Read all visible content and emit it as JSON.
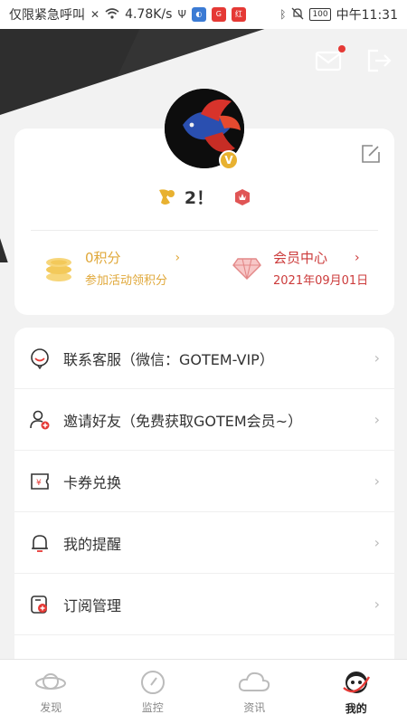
{
  "status_bar": {
    "left_text": "仅限紧急呼叫",
    "speed": "4.78K/s",
    "battery": "100",
    "time": "中午11:31"
  },
  "profile": {
    "badge_letter": "V",
    "username": "2！",
    "points": {
      "value": "0积分",
      "subtitle": "参加活动领积分"
    },
    "member": {
      "title": "会员中心",
      "date": "2021年09月01日"
    }
  },
  "menu": [
    {
      "label": "联系客服（微信：GOTEM-VIP）",
      "icon": "headset-icon"
    },
    {
      "label": "邀请好友（免费获取GOTEM会员~）",
      "icon": "invite-user-icon"
    },
    {
      "label": "卡券兑换",
      "icon": "coupon-icon"
    },
    {
      "label": "我的提醒",
      "icon": "bell-icon"
    },
    {
      "label": "订阅管理",
      "icon": "subscription-icon"
    }
  ],
  "tabs": [
    {
      "label": "发现",
      "icon": "planet-icon",
      "active": false
    },
    {
      "label": "监控",
      "icon": "compass-icon",
      "active": false
    },
    {
      "label": "资讯",
      "icon": "cloud-icon",
      "active": false
    },
    {
      "label": "我的",
      "icon": "profile-face-icon",
      "active": true
    }
  ],
  "colors": {
    "gold": "#e0a83a",
    "member_red": "#cc3b3b",
    "header_dark": "#2e2e2e",
    "notification_dot": "#e53935"
  }
}
